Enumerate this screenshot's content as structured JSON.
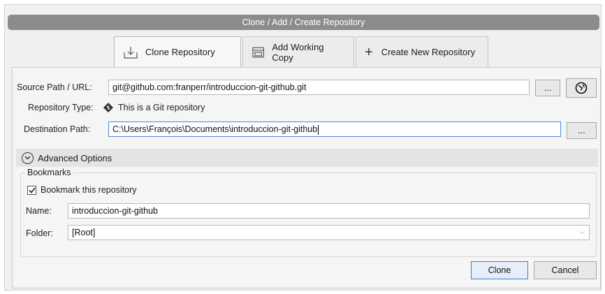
{
  "window": {
    "title": "Clone / Add / Create Repository"
  },
  "tabs": [
    {
      "label": "Clone Repository",
      "icon": "clone-download-icon",
      "active": true
    },
    {
      "label": "Add Working Copy",
      "icon": "folder-drive-icon",
      "active": false
    },
    {
      "label": "Create New Repository",
      "icon": "plus-icon",
      "active": false
    }
  ],
  "form": {
    "source_label": "Source Path / URL:",
    "source_value": "git@github.com:franperr/introduccion-git-github.git",
    "browse_label": "...",
    "remote_icon": "globe-icon",
    "repo_type_label": "Repository Type:",
    "repo_type_value": "This is a Git repository",
    "repo_type_icon": "git-diamond-icon",
    "dest_label": "Destination Path:",
    "dest_value": "C:\\Users\\François\\Documents\\introduccion-git-github",
    "dest_browse_label": "..."
  },
  "advanced": {
    "label": "Advanced Options",
    "icon": "chevron-down-circle-icon"
  },
  "bookmarks": {
    "title": "Bookmarks",
    "checkbox_label": "Bookmark this repository",
    "checked": true,
    "name_label": "Name:",
    "name_value": "introduccion-git-github",
    "folder_label": "Folder:",
    "folder_value": "[Root]"
  },
  "actions": {
    "clone_label": "Clone",
    "cancel_label": "Cancel"
  },
  "colors": {
    "accent": "#3c7fd6",
    "titlebar": "#8c8c8c"
  }
}
